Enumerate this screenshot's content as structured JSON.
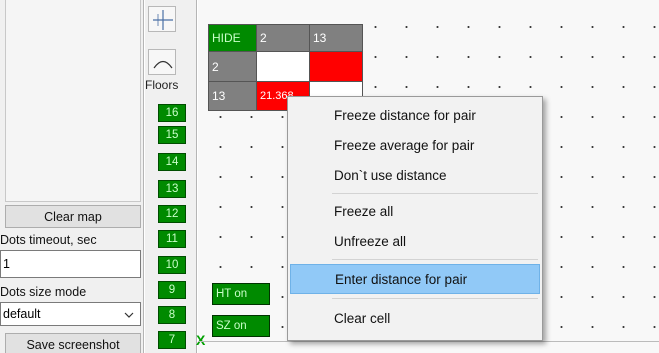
{
  "left_panel": {
    "clear_map_label": "Clear map",
    "dots_timeout_label": "Dots timeout, sec",
    "dots_timeout_value": "1",
    "dots_size_label": "Dots size mode",
    "dots_size_value": "default",
    "save_screenshot_label": "Save screenshot"
  },
  "floors": {
    "label": "Floors",
    "items": [
      "16",
      "15",
      "14",
      "13",
      "12",
      "11",
      "10",
      "9",
      "8",
      "7"
    ]
  },
  "grid": {
    "header": [
      "HIDE",
      "2",
      "13"
    ],
    "row1_label": "2",
    "row2_label": "13",
    "row2_value": "21.368",
    "colors": {
      "green": "#008a00",
      "gray": "#808080",
      "red": "#ff0000",
      "white": "#ffffff"
    }
  },
  "chips": {
    "ht": "HT on",
    "sz": "SZ on"
  },
  "axis_marker": "X",
  "context_menu": {
    "items": [
      "Freeze distance for pair",
      "Freeze average for pair",
      "Don`t use distance",
      "Freeze all",
      "Unfreeze all",
      "Enter distance for pair",
      "Clear cell"
    ],
    "highlighted": "Enter distance for pair"
  }
}
